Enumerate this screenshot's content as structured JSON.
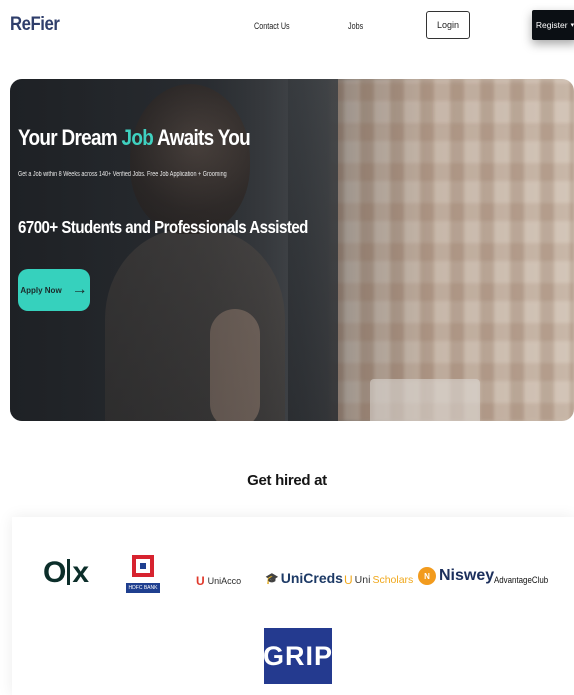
{
  "header": {
    "logo": "ReFier",
    "nav": {
      "contact": "Contact Us",
      "jobs": "Jobs"
    },
    "login_label": "Login",
    "register_label": "Register",
    "register_caret": "▾"
  },
  "hero": {
    "title_pre": "Your Dream ",
    "title_accent": "Job",
    "title_post": " Awaits You",
    "subtitle": "Get a Job within 8 Weeks across 140+ Verified Jobs. Free Job Application + Grooming",
    "stat": "6700+ Students and Professionals Assisted",
    "apply_label": "Apply Now",
    "apply_arrow": "→",
    "accent_color": "#36d1bd"
  },
  "companies": {
    "title": "Get hired at",
    "olx": {
      "o": "O",
      "x": "x"
    },
    "hdfc": {
      "band_text": "HDFC BANK"
    },
    "uniacco": {
      "mark": "U",
      "text": "UniAcco"
    },
    "unicreds": {
      "mark": "🎓",
      "text": "UniCreds"
    },
    "unischolars": {
      "mark": "U",
      "uni": "Uni",
      "sch": "Scholars"
    },
    "niswey": {
      "mark": "N",
      "text": "Niswey"
    },
    "advantageclub": "AdvantageClub",
    "grip": "GRIP"
  }
}
